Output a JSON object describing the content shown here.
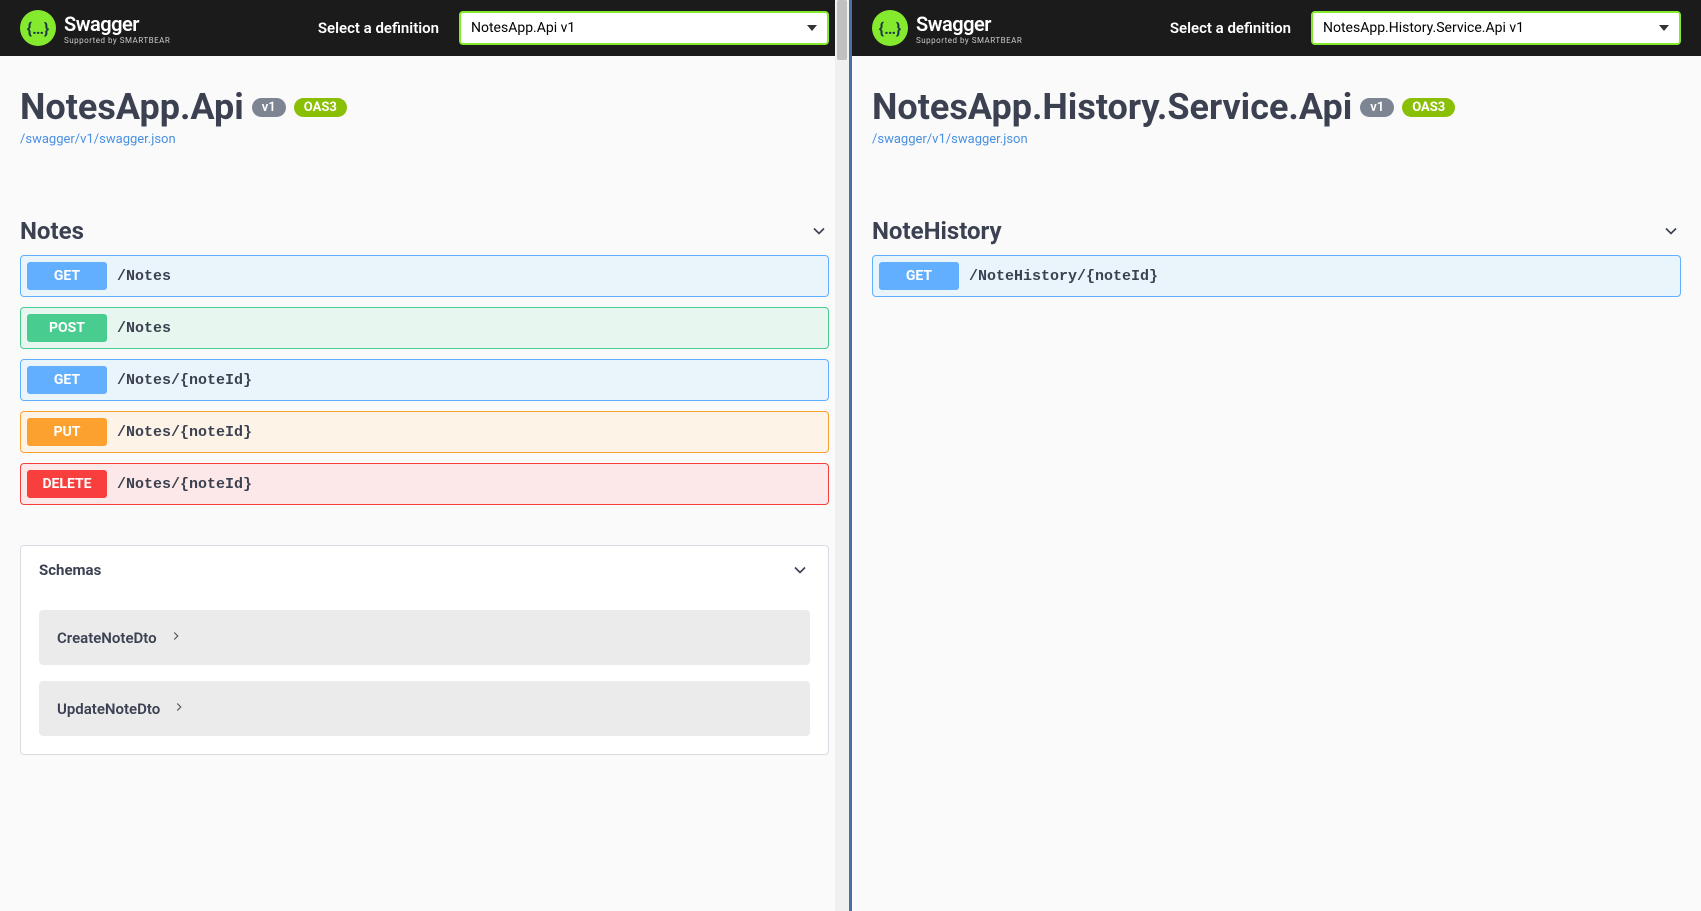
{
  "left": {
    "topbar": {
      "logo_title": "Swagger",
      "logo_sub": "Supported by SMARTBEAR",
      "def_label": "Select a definition",
      "def_value": "NotesApp.Api v1"
    },
    "api_title": "NotesApp.Api",
    "version": "v1",
    "oas": "OAS3",
    "json_link": "/swagger/v1/swagger.json",
    "tag": "Notes",
    "ops": [
      {
        "method": "GET",
        "path": "/Notes"
      },
      {
        "method": "POST",
        "path": "/Notes"
      },
      {
        "method": "GET",
        "path": "/Notes/{noteId}"
      },
      {
        "method": "PUT",
        "path": "/Notes/{noteId}"
      },
      {
        "method": "DELETE",
        "path": "/Notes/{noteId}"
      }
    ],
    "schemas_title": "Schemas",
    "schemas": [
      {
        "name": "CreateNoteDto"
      },
      {
        "name": "UpdateNoteDto"
      }
    ]
  },
  "right": {
    "topbar": {
      "logo_title": "Swagger",
      "logo_sub": "Supported by SMARTBEAR",
      "def_label": "Select a definition",
      "def_value": "NotesApp.History.Service.Api v1"
    },
    "api_title": "NotesApp.History.Service.Api",
    "version": "v1",
    "oas": "OAS3",
    "json_link": "/swagger/v1/swagger.json",
    "tag": "NoteHistory",
    "ops": [
      {
        "method": "GET",
        "path": "/NoteHistory/{noteId}"
      }
    ]
  }
}
